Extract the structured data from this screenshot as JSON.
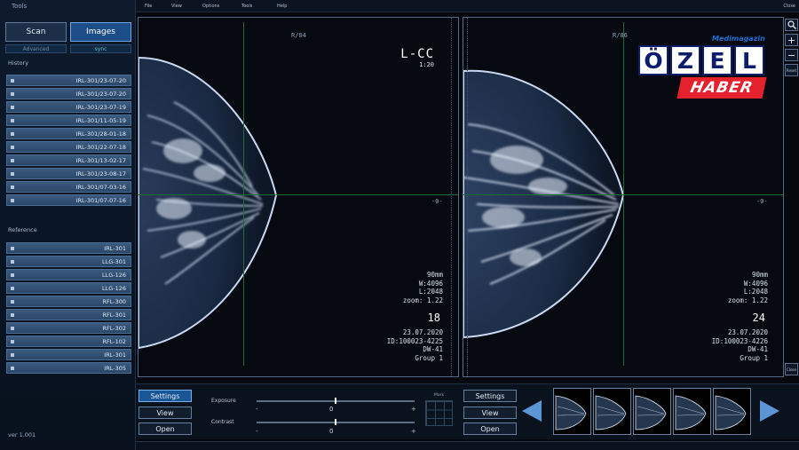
{
  "left_panel": {
    "title": "Tools",
    "scan_label": "Scan",
    "images_label": "Images",
    "advanced_label": "Advanced",
    "sync_label": "sync",
    "history_label": "History",
    "history": [
      "IRL-301/23-07-20",
      "IRL-301/23-07-20",
      "IRL-301/23-07-19",
      "IRL-301/11-05-19",
      "IRL-301/28-01-18",
      "IRL-301/22-07-18",
      "IRL-301/13-02-17",
      "IRL-301/23-08-17",
      "IRL-301/07-03-16",
      "IRL-301/07-07-16"
    ],
    "reference_label": "Reference",
    "reference": [
      "IRL-301",
      "LLG-301",
      "LLG-126",
      "LLG-126",
      "RFL-300",
      "RFL-301",
      "RFL-302",
      "RFL-102",
      "IRL-301",
      "IRL-305"
    ],
    "version": "ver 1.001"
  },
  "menubar": {
    "items": [
      "File",
      "View",
      "Options",
      "Tools",
      "Help"
    ],
    "close_label": "Close"
  },
  "viewport_left": {
    "orientation": "R/04",
    "title": "L-CC",
    "scale": "1:20",
    "center_marker": "-0-",
    "info": [
      "90mm",
      "W:4096",
      "L:2048",
      "zoom: 1.22"
    ],
    "image_number": "18",
    "date": "23.07.2020",
    "id": "ID:100023-4225",
    "device": "DW-41",
    "group": "Group 1"
  },
  "viewport_right": {
    "orientation": "R/06",
    "center_marker": "-0-",
    "info": [
      "90mm",
      "W:4096",
      "L:2048",
      "zoom: 1.22"
    ],
    "image_number": "24",
    "date": "23.07.2020",
    "id": "ID:100023-4226",
    "device": "DW-41",
    "group": "Group 1"
  },
  "right_toolbar": {
    "search_icon": "magnifier-icon",
    "zoom_in": "+",
    "zoom_out": "−",
    "reset_label": "Reset",
    "close_label": "Close"
  },
  "bottom_bar": {
    "settings_label": "Settings",
    "view_label": "View",
    "open_label": "Open",
    "exposure_label": "Exposure",
    "exposure_value": "0",
    "exposure_level": 0.5,
    "contrast_label": "Contrast",
    "contrast_value": "0",
    "contrast_level": 0.5,
    "minus": "-",
    "plus": "+",
    "mark_label": "Mark",
    "settings2_label": "Settings",
    "view2_label": "View",
    "open2_label": "Open",
    "thumbnail_count": 5
  },
  "watermark": {
    "brand": "Medimagazin",
    "letters": [
      "Ö",
      "Z",
      "E",
      "L"
    ],
    "tag": "HABER",
    "colors": {
      "navy": "#0c1d6e",
      "red": "#e3222e"
    }
  },
  "colors": {
    "accent": "#1a5696",
    "crosshair": "#1f6b3a",
    "tissue": "#cfe0ff"
  }
}
